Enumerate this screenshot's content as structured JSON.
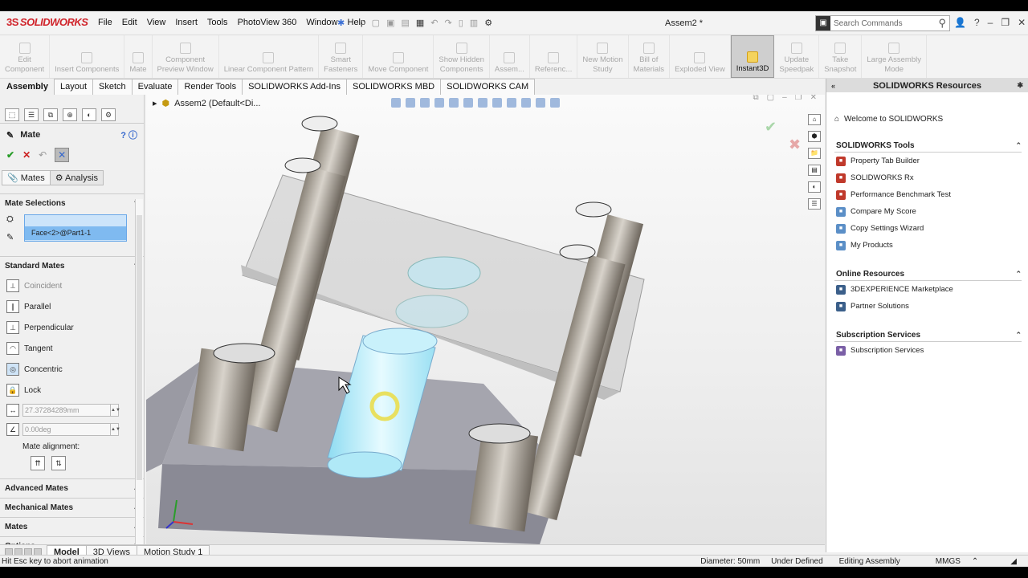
{
  "titlebar": {
    "logo_ds": "3S",
    "logo_text": "SOLIDWORKS",
    "menu": [
      "File",
      "Edit",
      "View",
      "Insert",
      "Tools",
      "PhotoView 360",
      "Window",
      "Help"
    ],
    "doc_title": "Assem2 *",
    "search_placeholder": "Search Commands"
  },
  "commands": [
    {
      "label": "Edit\nComponent"
    },
    {
      "label": "Insert Components"
    },
    {
      "label": "Mate"
    },
    {
      "label": "Component\nPreview Window"
    },
    {
      "label": "Linear Component Pattern"
    },
    {
      "label": "Smart\nFasteners"
    },
    {
      "label": "Move Component"
    },
    {
      "label": "Show Hidden\nComponents"
    },
    {
      "label": "Assem..."
    },
    {
      "label": "Referenc..."
    },
    {
      "label": "New Motion\nStudy"
    },
    {
      "label": "Bill of\nMaterials"
    },
    {
      "label": "Exploded View"
    },
    {
      "label": "Instant3D"
    },
    {
      "label": "Update\nSpeedpak"
    },
    {
      "label": "Take\nSnapshot"
    },
    {
      "label": "Large Assembly\nMode"
    }
  ],
  "active_command_index": 13,
  "cmd_tabs": [
    "Assembly",
    "Layout",
    "Sketch",
    "Evaluate",
    "Render Tools",
    "SOLIDWORKS Add-Ins",
    "SOLIDWORKS MBD",
    "SOLIDWORKS CAM"
  ],
  "property_manager": {
    "title": "Mate",
    "tabs": [
      "Mates",
      "Analysis"
    ],
    "mate_selections_label": "Mate Selections",
    "selection_value": "Face<2>@Part1-1",
    "standard_mates_label": "Standard Mates",
    "standard_mates": [
      "Coincident",
      "Parallel",
      "Perpendicular",
      "Tangent",
      "Concentric",
      "Lock"
    ],
    "distance_value": "27.37284289mm",
    "angle_value": "0.00deg",
    "mate_alignment_label": "Mate alignment:",
    "advanced_mates_label": "Advanced Mates",
    "mechanical_mates_label": "Mechanical Mates",
    "mates_label": "Mates",
    "options_label": "Options"
  },
  "graphics": {
    "tree_fly": "Assem2  (Default<Di..."
  },
  "resources": {
    "title": "SOLIDWORKS Resources",
    "welcome": "Welcome to SOLIDWORKS",
    "sections": [
      {
        "title": "SOLIDWORKS Tools",
        "items": [
          "Property Tab Builder",
          "SOLIDWORKS Rx",
          "Performance Benchmark Test",
          "Compare My Score",
          "Copy Settings Wizard",
          "My Products"
        ]
      },
      {
        "title": "Online Resources",
        "items": [
          "3DEXPERIENCE Marketplace",
          "Partner Solutions"
        ]
      },
      {
        "title": "Subscription Services",
        "items": [
          "Subscription Services"
        ]
      }
    ]
  },
  "bottom_tabs": [
    "Model",
    "3D Views",
    "Motion Study 1"
  ],
  "status": {
    "message": "Hit Esc key to abort animation",
    "diameter": "Diameter: 50mm",
    "state": "Under Defined",
    "mode": "Editing Assembly",
    "units": "MMGS"
  }
}
